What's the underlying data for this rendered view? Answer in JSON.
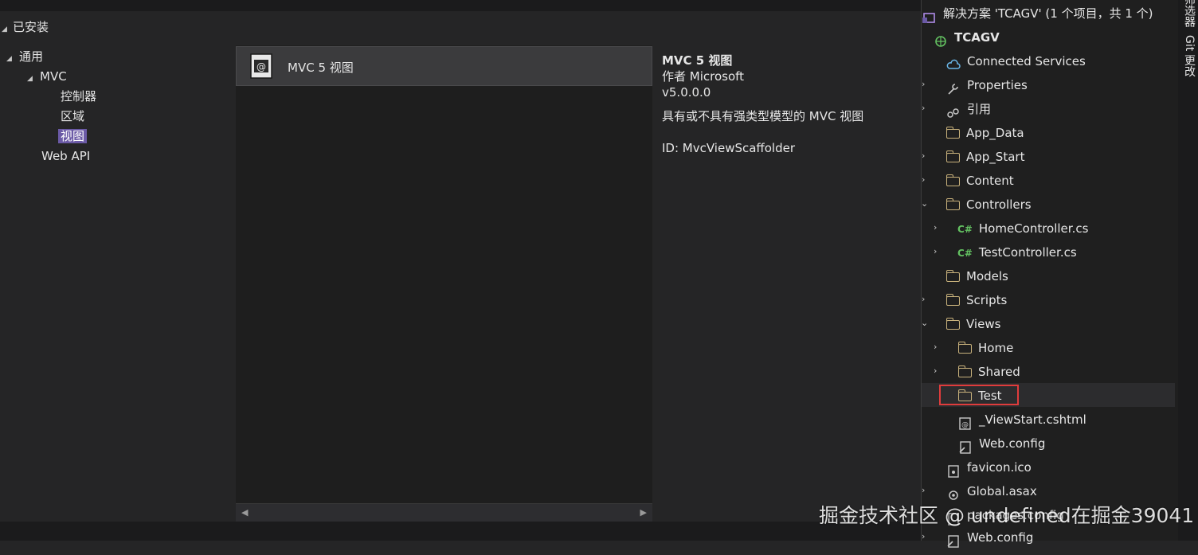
{
  "dialog": {
    "installed_label": "已安装",
    "categories": [
      {
        "label": "通用"
      },
      {
        "label": "MVC"
      },
      {
        "label": "控制器"
      },
      {
        "label": "区域"
      },
      {
        "label": "视图"
      },
      {
        "label": "Web API"
      }
    ],
    "templates": [
      {
        "name": "MVC 5 视图"
      }
    ],
    "description": {
      "title": "MVC 5 视图",
      "author": "作者 Microsoft",
      "version": "v5.0.0.0",
      "summary": "具有或不具有强类型模型的 MVC 视图",
      "id": "ID: MvcViewScaffolder"
    }
  },
  "solution_explorer": {
    "nodes": [
      {
        "label": "解决方案 'TCAGV' (1 个项目，共 1 个)"
      },
      {
        "label": "TCAGV"
      },
      {
        "label": "Connected Services"
      },
      {
        "label": "Properties"
      },
      {
        "label": "引用"
      },
      {
        "label": "App_Data"
      },
      {
        "label": "App_Start"
      },
      {
        "label": "Content"
      },
      {
        "label": "Controllers"
      },
      {
        "label": "HomeController.cs"
      },
      {
        "label": "TestController.cs"
      },
      {
        "label": "Models"
      },
      {
        "label": "Scripts"
      },
      {
        "label": "Views"
      },
      {
        "label": "Home"
      },
      {
        "label": "Shared"
      },
      {
        "label": "Test"
      },
      {
        "label": "_ViewStart.cshtml"
      },
      {
        "label": "Web.config"
      },
      {
        "label": "favicon.ico"
      },
      {
        "label": "Global.asax"
      },
      {
        "label": "packages.config"
      },
      {
        "label": "Web.config"
      }
    ]
  },
  "side_tabs": [
    "筛选器",
    "Git 更改"
  ],
  "watermark": "掘金技术社区 @ undefined在掘金39041",
  "colors": {
    "selection": "#6b5aa6",
    "highlight_box": "#e03c3c",
    "folder": "#c9b27c",
    "csharp": "#63c161"
  }
}
